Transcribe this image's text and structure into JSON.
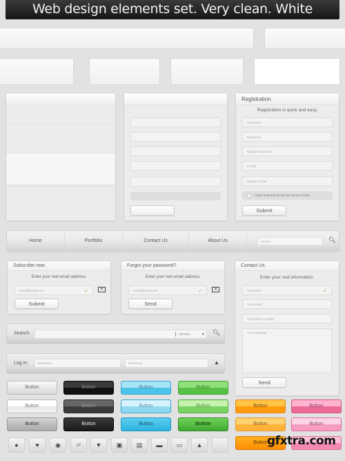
{
  "title": "Web design elements set. Very clean. White",
  "navigation": {
    "items": [
      "Home",
      "Portfolio",
      "Contact Us",
      "About Us"
    ],
    "search_placeholder": "Search ..."
  },
  "registration": {
    "heading": "Registration",
    "subtitle": "Registration is quick and easy.",
    "fields": [
      "Username",
      "Password",
      "Retype Password",
      "E-Mail",
      "Retype E-Mail"
    ],
    "terms_label": "I have read and accept the Terms of Use",
    "submit_label": "Submit"
  },
  "subscribe": {
    "heading": "Subscribe now",
    "subtitle": "Enter your real email address.",
    "email_placeholder": "email@email.com",
    "submit_label": "Submit"
  },
  "forgot_password": {
    "heading": "Forgot your password?",
    "subtitle": "Enter your real email address.",
    "email_placeholder": "email@email.com",
    "send_label": "Send"
  },
  "contact": {
    "heading": "Contact Us",
    "subtitle": "Enter your real information.",
    "fields": [
      "Your name",
      "Your email",
      "Your phone number"
    ],
    "message_placeholder": "Your message",
    "send_label": "Send"
  },
  "search_bar": {
    "label": "Search:",
    "scope": "All Files..."
  },
  "login_bar": {
    "label": "Log in:",
    "nickname_placeholder": "Nickname",
    "password_placeholder": "Password"
  },
  "buttons": {
    "label": "Button",
    "colors": {
      "silver": "#d9d9d9",
      "black": "#1e1e1e",
      "blue": "#4cc3ea",
      "green": "#63c94c",
      "orange": "#ffa31a",
      "pink": "#f07aa5"
    }
  },
  "icons": [
    "camera-icon",
    "heart-icon",
    "eye-icon",
    "rss-icon",
    "cart-icon",
    "lock-icon",
    "briefcase-icon",
    "wallet-icon",
    "chat-icon",
    "home-icon",
    "blank-icon"
  ],
  "watermark": "gfxtra.com"
}
